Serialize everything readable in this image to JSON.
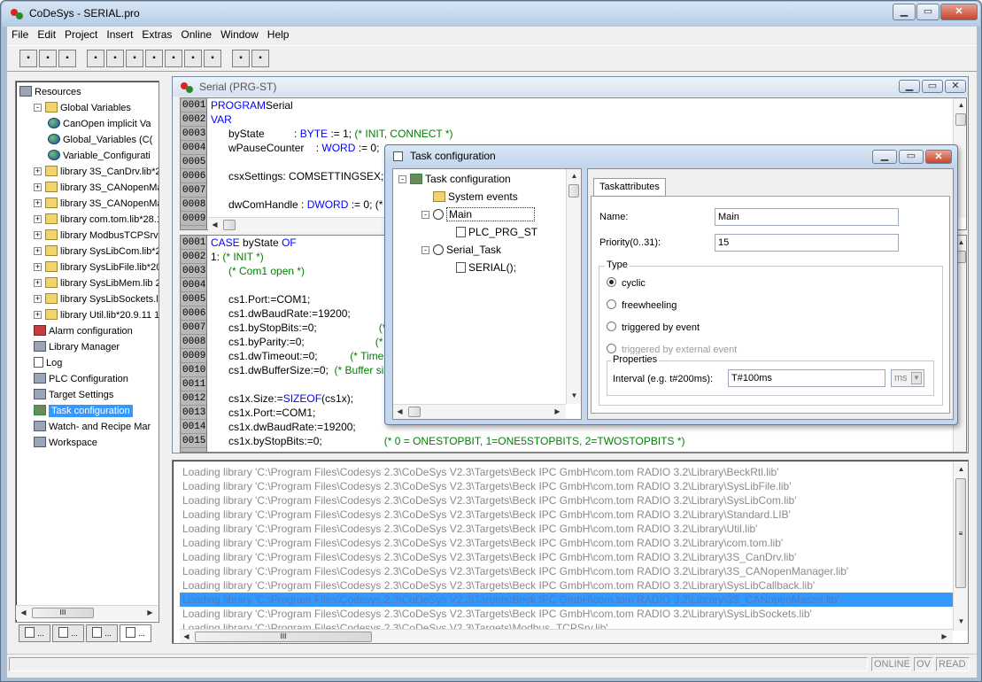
{
  "app": {
    "title": "CoDeSys - SERIAL.pro"
  },
  "menu": [
    "File",
    "Edit",
    "Project",
    "Insert",
    "Extras",
    "Online",
    "Window",
    "Help"
  ],
  "toolbar": {
    "buttons": [
      "new-icon",
      "open-icon",
      "save-icon",
      "build-icon",
      "login-icon",
      "logout-icon",
      "run-icon",
      "stop-icon",
      "step-icon",
      "print-icon",
      "find-icon",
      "replace-icon"
    ]
  },
  "resources": {
    "items": [
      {
        "label": "Resources",
        "icon": "resources-icon",
        "level": 0,
        "expander": ""
      },
      {
        "label": "Global Variables",
        "icon": "folder-icon",
        "level": 1,
        "expander": "-"
      },
      {
        "label": "CanOpen implicit Va",
        "icon": "globe-icon",
        "level": 2,
        "expander": ""
      },
      {
        "label": "Global_Variables (C(",
        "icon": "globe-icon",
        "level": 2,
        "expander": ""
      },
      {
        "label": "Variable_Configurati",
        "icon": "globe-icon",
        "level": 2,
        "expander": ""
      },
      {
        "label": "library 3S_CanDrv.lib*20",
        "icon": "folder-icon",
        "level": 1,
        "expander": "+"
      },
      {
        "label": "library 3S_CANopenMar",
        "icon": "folder-icon",
        "level": 1,
        "expander": "+"
      },
      {
        "label": "library 3S_CANopenMas",
        "icon": "folder-icon",
        "level": 1,
        "expander": "+"
      },
      {
        "label": "library com.tom.lib*28.10",
        "icon": "folder-icon",
        "level": 1,
        "expander": "+"
      },
      {
        "label": "library ModbusTCPSrv.li",
        "icon": "folder-icon",
        "level": 1,
        "expander": "+"
      },
      {
        "label": "library SysLibCom.lib*20.",
        "icon": "folder-icon",
        "level": 1,
        "expander": "+"
      },
      {
        "label": "library SysLibFile.lib*20.9",
        "icon": "folder-icon",
        "level": 1,
        "expander": "+"
      },
      {
        "label": "library SysLibMem.lib 2.4",
        "icon": "folder-icon",
        "level": 1,
        "expander": "+"
      },
      {
        "label": "library SysLibSockets.lib",
        "icon": "folder-icon",
        "level": 1,
        "expander": "+"
      },
      {
        "label": "library Util.lib*20.9.11 11",
        "icon": "folder-icon",
        "level": 1,
        "expander": "+"
      },
      {
        "label": "Alarm configuration",
        "icon": "alarm-icon",
        "level": 1,
        "expander": ""
      },
      {
        "label": "Library Manager",
        "icon": "book-icon",
        "level": 1,
        "expander": ""
      },
      {
        "label": "Log",
        "icon": "log-icon",
        "level": 1,
        "expander": ""
      },
      {
        "label": "PLC Configuration",
        "icon": "plc-icon",
        "level": 1,
        "expander": ""
      },
      {
        "label": "Target Settings",
        "icon": "target-icon",
        "level": 1,
        "expander": ""
      },
      {
        "label": "Task configuration",
        "icon": "task-icon",
        "level": 1,
        "expander": "",
        "selected": true
      },
      {
        "label": "Watch- and Recipe Mar",
        "icon": "magnifier-icon",
        "level": 1,
        "expander": ""
      },
      {
        "label": "Workspace",
        "icon": "tools-icon",
        "level": 1,
        "expander": ""
      }
    ],
    "bottom_tabs": [
      "POUs",
      "Data types",
      "Visualizations",
      "Resources"
    ],
    "scroll_label": "III"
  },
  "editor": {
    "title": "Serial (PRG-ST)",
    "decl": [
      {
        "n": "0001",
        "t": [
          [
            "kw",
            "PROGRAM"
          ],
          [
            "",
            "Serial"
          ]
        ]
      },
      {
        "n": "0002",
        "t": [
          [
            "kw",
            "VAR"
          ]
        ]
      },
      {
        "n": "0003",
        "t": [
          [
            "",
            "      byState          : "
          ],
          [
            "kw",
            "BYTE"
          ],
          [
            "",
            " := 1; "
          ],
          [
            "cm",
            "(* INIT, CONNECT *)"
          ]
        ]
      },
      {
        "n": "0004",
        "t": [
          [
            "",
            "      wPauseCounter    : "
          ],
          [
            "kw",
            "WORD"
          ],
          [
            "",
            " := 0;"
          ]
        ]
      },
      {
        "n": "0005",
        "t": [
          [
            "",
            ""
          ]
        ]
      },
      {
        "n": "0006",
        "t": [
          [
            "",
            "      csxSettings: COMSETTINGSEX;"
          ]
        ]
      },
      {
        "n": "0007",
        "t": [
          [
            "",
            ""
          ]
        ]
      },
      {
        "n": "0008",
        "t": [
          [
            "",
            "      dwComHandle : "
          ],
          [
            "kw",
            "DWORD"
          ],
          [
            "",
            " := 0; (*"
          ]
        ]
      },
      {
        "n": "0009",
        "t": [
          [
            "",
            ""
          ]
        ]
      }
    ],
    "body": [
      {
        "n": "0001",
        "t": [
          [
            "kw",
            "CASE"
          ],
          [
            "",
            " byState "
          ],
          [
            "kw",
            "OF"
          ]
        ]
      },
      {
        "n": "0002",
        "t": [
          [
            "",
            "1: "
          ],
          [
            "cm",
            "(* INIT *)"
          ]
        ]
      },
      {
        "n": "0003",
        "t": [
          [
            "",
            "      "
          ],
          [
            "cm",
            "(* Com1 open *)"
          ]
        ]
      },
      {
        "n": "0004",
        "t": [
          [
            "",
            ""
          ]
        ]
      },
      {
        "n": "0005",
        "t": [
          [
            "",
            "      cs1.Port:=COM1;"
          ]
        ]
      },
      {
        "n": "0006",
        "t": [
          [
            "",
            "      cs1.dwBaudRate:=19200;"
          ]
        ]
      },
      {
        "n": "0007",
        "t": [
          [
            "",
            "      cs1.byStopBits:=0;"
          ],
          [
            "cm",
            "                     (* 0"
          ]
        ]
      },
      {
        "n": "0008",
        "t": [
          [
            "",
            "      cs1.byParity:=0;"
          ],
          [
            "cm",
            "                        (* 0"
          ]
        ]
      },
      {
        "n": "0009",
        "t": [
          [
            "",
            "      cs1.dwTimeout:=0;"
          ],
          [
            "cm",
            "           (* Time"
          ]
        ]
      },
      {
        "n": "0010",
        "t": [
          [
            "",
            "      cs1.dwBufferSize:=0;  "
          ],
          [
            "cm",
            "(* Buffer siz"
          ]
        ]
      },
      {
        "n": "0011",
        "t": [
          [
            "",
            ""
          ]
        ]
      },
      {
        "n": "0012",
        "t": [
          [
            "",
            "      cs1x.Size:="
          ],
          [
            "kw",
            "SIZEOF"
          ],
          [
            "",
            "(cs1x);"
          ]
        ]
      },
      {
        "n": "0013",
        "t": [
          [
            "",
            "      cs1x.Port:=COM1;"
          ]
        ]
      },
      {
        "n": "0014",
        "t": [
          [
            "",
            "      cs1x.dwBaudRate:=19200;"
          ]
        ]
      },
      {
        "n": "0015",
        "t": [
          [
            "",
            "      cs1x.byStopBits:=0;"
          ],
          [
            "cm",
            "                     (* 0 = ONESTOPBIT, 1=ONE5STOPBITS, 2=TWOSTOPBITS *)"
          ]
        ]
      }
    ]
  },
  "messages": {
    "lines": [
      "Loading library 'C:\\Program Files\\Codesys 2.3\\CoDeSys V2.3\\Targets\\Beck IPC GmbH\\com.tom RADIO 3.2\\Library\\BeckRtl.lib'",
      "Loading library 'C:\\Program Files\\Codesys 2.3\\CoDeSys V2.3\\Targets\\Beck IPC GmbH\\com.tom RADIO 3.2\\Library\\SysLibFile.lib'",
      "Loading library 'C:\\Program Files\\Codesys 2.3\\CoDeSys V2.3\\Targets\\Beck IPC GmbH\\com.tom RADIO 3.2\\Library\\SysLibCom.lib'",
      "Loading library 'C:\\Program Files\\Codesys 2.3\\CoDeSys V2.3\\Targets\\Beck IPC GmbH\\com.tom RADIO 3.2\\Library\\Standard.LIB'",
      "Loading library 'C:\\Program Files\\Codesys 2.3\\CoDeSys V2.3\\Targets\\Beck IPC GmbH\\com.tom RADIO 3.2\\Library\\Util.lib'",
      "Loading library 'C:\\Program Files\\Codesys 2.3\\CoDeSys V2.3\\Targets\\Beck IPC GmbH\\com.tom RADIO 3.2\\Library\\com.tom.lib'",
      "Loading library 'C:\\Program Files\\Codesys 2.3\\CoDeSys V2.3\\Targets\\Beck IPC GmbH\\com.tom RADIO 3.2\\Library\\3S_CanDrv.lib'",
      "Loading library 'C:\\Program Files\\Codesys 2.3\\CoDeSys V2.3\\Targets\\Beck IPC GmbH\\com.tom RADIO 3.2\\Library\\3S_CANopenManager.lib'",
      "Loading library 'C:\\Program Files\\Codesys 2.3\\CoDeSys V2.3\\Targets\\Beck IPC GmbH\\com.tom RADIO 3.2\\Library\\SysLibCallback.lib'",
      "Loading library 'C:\\Program Files\\Codesys 2.3\\CoDeSys V2.3\\Targets\\Beck IPC GmbH\\com.tom RADIO 3.2\\Library\\3S_CANopenMaster.lib'",
      "Loading library 'C:\\Program Files\\Codesys 2.3\\CoDeSys V2.3\\Targets\\Beck IPC GmbH\\com.tom RADIO 3.2\\Library\\SysLibSockets.lib'",
      "Loading library 'C:\\Program Files\\Codesys 2.3\\CoDeSys V2.3\\Targets\\Modbus_TCPSrv.lib'"
    ],
    "selected_index": 9
  },
  "task_dialog": {
    "title": "Task configuration",
    "tree": [
      {
        "label": "Task configuration",
        "icon": "task-config-icon",
        "level": 0,
        "expander": "-"
      },
      {
        "label": "System events",
        "icon": "lightning-icon",
        "level": 1,
        "expander": ""
      },
      {
        "label": "Main",
        "icon": "clock-icon",
        "level": 1,
        "expander": "-",
        "focused": true
      },
      {
        "label": "PLC_PRG_ST",
        "icon": "document-icon",
        "level": 2,
        "expander": ""
      },
      {
        "label": "Serial_Task",
        "icon": "clock-icon",
        "level": 1,
        "expander": "-"
      },
      {
        "label": "SERIAL();",
        "icon": "document-icon",
        "level": 2,
        "expander": ""
      }
    ],
    "tab": "Taskattributes",
    "name_label": "Name:",
    "name_value": "Main",
    "priority_label": "Priority(0..31):",
    "priority_value": "15",
    "type_label": "Type",
    "radios": [
      {
        "label": "cyclic",
        "checked": true,
        "disabled": false
      },
      {
        "label": "freewheeling",
        "checked": false,
        "disabled": false
      },
      {
        "label": "triggered by event",
        "checked": false,
        "disabled": false
      },
      {
        "label": "triggered by external event",
        "checked": false,
        "disabled": true
      }
    ],
    "properties_label": "Properties",
    "interval_label": "Interval (e.g. t#200ms):",
    "interval_value": "T#100ms",
    "unit_value": "ms"
  },
  "status": {
    "online": "ONLINE",
    "ov": "OV",
    "read": "READ"
  }
}
